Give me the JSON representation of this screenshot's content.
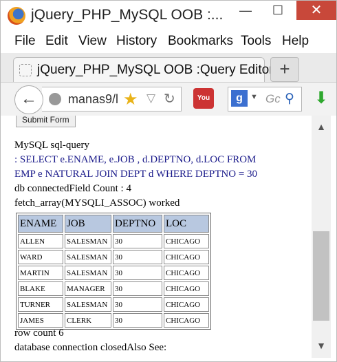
{
  "window": {
    "title": "jQuery_PHP_MySQL OOB :...",
    "controls": {
      "minimize": "—",
      "maximize": "☐",
      "close": "✕"
    }
  },
  "menu": [
    "File",
    "Edit",
    "View",
    "History",
    "Bookmarks",
    "Tools",
    "Help"
  ],
  "tab": {
    "label": "jQuery_PHP_MySQL OOB :Query Editor",
    "new_tab": "+"
  },
  "nav": {
    "back": "←",
    "url": "manas9/l",
    "search_placeholder": "Gc",
    "youtube_label": "You",
    "search_engine": "g"
  },
  "content": {
    "submit_label": "Submit Form",
    "sql_heading": "MySQL sql-query",
    "query_line1": ": SELECT e.ENAME, e.JOB , d.DEPTNO, d.LOC FROM",
    "query_line2": "EMP e NATURAL JOIN DEPT d WHERE DEPTNO = 30",
    "db_status": "db connectedField Count : 4",
    "fetch_status": "fetch_array(MYSQLI_ASSOC) worked",
    "table": {
      "headers": [
        "ENAME",
        "JOB",
        "DEPTNO",
        "LOC"
      ],
      "rows": [
        [
          "ALLEN",
          "SALESMAN",
          "30",
          "CHICAGO"
        ],
        [
          "WARD",
          "SALESMAN",
          "30",
          "CHICAGO"
        ],
        [
          "MARTIN",
          "SALESMAN",
          "30",
          "CHICAGO"
        ],
        [
          "BLAKE",
          "MANAGER",
          "30",
          "CHICAGO"
        ],
        [
          "TURNER",
          "SALESMAN",
          "30",
          "CHICAGO"
        ],
        [
          "JAMES",
          "CLERK",
          "30",
          "CHICAGO"
        ]
      ]
    },
    "row_count": "row count 6",
    "closed": "database connection closedAlso See:"
  },
  "scrollbar": {
    "up": "▲",
    "down": "▼"
  }
}
